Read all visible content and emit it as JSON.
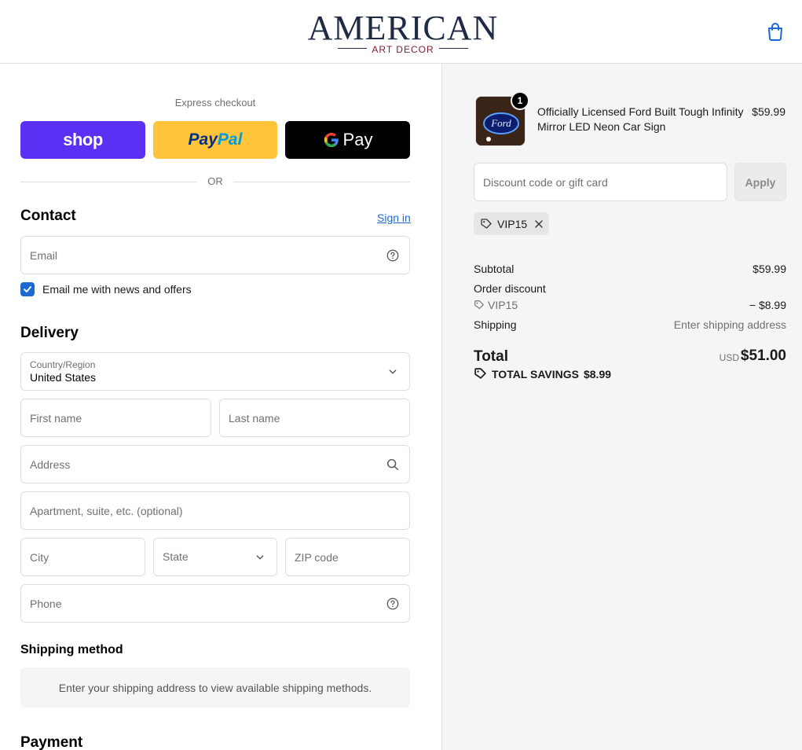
{
  "header": {
    "logo_main": "AMERICAN",
    "logo_sub": "ART DECOR",
    "cart_icon": "shopping-bag-icon"
  },
  "express": {
    "title": "Express checkout",
    "shop_label": "shop",
    "paypal_label_1": "Pay",
    "paypal_label_2": "Pal",
    "gpay_label": "Pay",
    "or_text": "OR"
  },
  "contact": {
    "title": "Contact",
    "sign_in": "Sign in",
    "email_placeholder": "Email",
    "newsletter_label": "Email me with news and offers",
    "newsletter_checked": true
  },
  "delivery": {
    "title": "Delivery",
    "country_label": "Country/Region",
    "country_value": "United States",
    "first_name_placeholder": "First name",
    "last_name_placeholder": "Last name",
    "address_placeholder": "Address",
    "apartment_placeholder": "Apartment, suite, etc. (optional)",
    "city_placeholder": "City",
    "state_placeholder": "State",
    "zip_placeholder": "ZIP code",
    "phone_placeholder": "Phone"
  },
  "shipping": {
    "title": "Shipping method",
    "message": "Enter your shipping address to view available shipping methods."
  },
  "payment": {
    "title": "Payment"
  },
  "order": {
    "product_name": "Officially Licensed Ford Built Tough Infinity Mirror LED Neon Car Sign",
    "product_price": "$59.99",
    "quantity": "1",
    "thumb_text": "Ford",
    "discount_placeholder": "Discount code or gift card",
    "apply_label": "Apply",
    "applied_code": "VIP15",
    "subtotal_label": "Subtotal",
    "subtotal_value": "$59.99",
    "order_discount_label": "Order discount",
    "discount_code": "VIP15",
    "discount_value": "− $8.99",
    "shipping_label": "Shipping",
    "shipping_value": "Enter shipping address",
    "total_label": "Total",
    "total_currency": "USD",
    "total_value": "$51.00",
    "savings_label": "TOTAL SAVINGS",
    "savings_value": "$8.99"
  },
  "colors": {
    "accent": "#1a6ad1",
    "shop_purple": "#5a31f4",
    "paypal_yellow": "#ffc439",
    "panel_bg": "#f5f5f5"
  }
}
